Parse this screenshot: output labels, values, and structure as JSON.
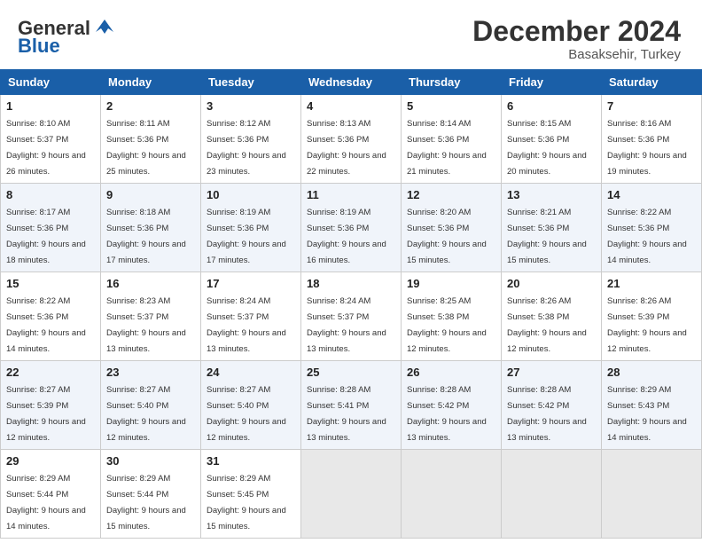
{
  "header": {
    "logo_general": "General",
    "logo_blue": "Blue",
    "month_title": "December 2024",
    "location": "Basaksehir, Turkey"
  },
  "calendar": {
    "days_of_week": [
      "Sunday",
      "Monday",
      "Tuesday",
      "Wednesday",
      "Thursday",
      "Friday",
      "Saturday"
    ],
    "weeks": [
      [
        {
          "day": "1",
          "sunrise": "8:10 AM",
          "sunset": "5:37 PM",
          "daylight": "9 hours and 26 minutes."
        },
        {
          "day": "2",
          "sunrise": "8:11 AM",
          "sunset": "5:36 PM",
          "daylight": "9 hours and 25 minutes."
        },
        {
          "day": "3",
          "sunrise": "8:12 AM",
          "sunset": "5:36 PM",
          "daylight": "9 hours and 23 minutes."
        },
        {
          "day": "4",
          "sunrise": "8:13 AM",
          "sunset": "5:36 PM",
          "daylight": "9 hours and 22 minutes."
        },
        {
          "day": "5",
          "sunrise": "8:14 AM",
          "sunset": "5:36 PM",
          "daylight": "9 hours and 21 minutes."
        },
        {
          "day": "6",
          "sunrise": "8:15 AM",
          "sunset": "5:36 PM",
          "daylight": "9 hours and 20 minutes."
        },
        {
          "day": "7",
          "sunrise": "8:16 AM",
          "sunset": "5:36 PM",
          "daylight": "9 hours and 19 minutes."
        }
      ],
      [
        {
          "day": "8",
          "sunrise": "8:17 AM",
          "sunset": "5:36 PM",
          "daylight": "9 hours and 18 minutes."
        },
        {
          "day": "9",
          "sunrise": "8:18 AM",
          "sunset": "5:36 PM",
          "daylight": "9 hours and 17 minutes."
        },
        {
          "day": "10",
          "sunrise": "8:19 AM",
          "sunset": "5:36 PM",
          "daylight": "9 hours and 17 minutes."
        },
        {
          "day": "11",
          "sunrise": "8:19 AM",
          "sunset": "5:36 PM",
          "daylight": "9 hours and 16 minutes."
        },
        {
          "day": "12",
          "sunrise": "8:20 AM",
          "sunset": "5:36 PM",
          "daylight": "9 hours and 15 minutes."
        },
        {
          "day": "13",
          "sunrise": "8:21 AM",
          "sunset": "5:36 PM",
          "daylight": "9 hours and 15 minutes."
        },
        {
          "day": "14",
          "sunrise": "8:22 AM",
          "sunset": "5:36 PM",
          "daylight": "9 hours and 14 minutes."
        }
      ],
      [
        {
          "day": "15",
          "sunrise": "8:22 AM",
          "sunset": "5:36 PM",
          "daylight": "9 hours and 14 minutes."
        },
        {
          "day": "16",
          "sunrise": "8:23 AM",
          "sunset": "5:37 PM",
          "daylight": "9 hours and 13 minutes."
        },
        {
          "day": "17",
          "sunrise": "8:24 AM",
          "sunset": "5:37 PM",
          "daylight": "9 hours and 13 minutes."
        },
        {
          "day": "18",
          "sunrise": "8:24 AM",
          "sunset": "5:37 PM",
          "daylight": "9 hours and 13 minutes."
        },
        {
          "day": "19",
          "sunrise": "8:25 AM",
          "sunset": "5:38 PM",
          "daylight": "9 hours and 12 minutes."
        },
        {
          "day": "20",
          "sunrise": "8:26 AM",
          "sunset": "5:38 PM",
          "daylight": "9 hours and 12 minutes."
        },
        {
          "day": "21",
          "sunrise": "8:26 AM",
          "sunset": "5:39 PM",
          "daylight": "9 hours and 12 minutes."
        }
      ],
      [
        {
          "day": "22",
          "sunrise": "8:27 AM",
          "sunset": "5:39 PM",
          "daylight": "9 hours and 12 minutes."
        },
        {
          "day": "23",
          "sunrise": "8:27 AM",
          "sunset": "5:40 PM",
          "daylight": "9 hours and 12 minutes."
        },
        {
          "day": "24",
          "sunrise": "8:27 AM",
          "sunset": "5:40 PM",
          "daylight": "9 hours and 12 minutes."
        },
        {
          "day": "25",
          "sunrise": "8:28 AM",
          "sunset": "5:41 PM",
          "daylight": "9 hours and 13 minutes."
        },
        {
          "day": "26",
          "sunrise": "8:28 AM",
          "sunset": "5:42 PM",
          "daylight": "9 hours and 13 minutes."
        },
        {
          "day": "27",
          "sunrise": "8:28 AM",
          "sunset": "5:42 PM",
          "daylight": "9 hours and 13 minutes."
        },
        {
          "day": "28",
          "sunrise": "8:29 AM",
          "sunset": "5:43 PM",
          "daylight": "9 hours and 14 minutes."
        }
      ],
      [
        {
          "day": "29",
          "sunrise": "8:29 AM",
          "sunset": "5:44 PM",
          "daylight": "9 hours and 14 minutes."
        },
        {
          "day": "30",
          "sunrise": "8:29 AM",
          "sunset": "5:44 PM",
          "daylight": "9 hours and 15 minutes."
        },
        {
          "day": "31",
          "sunrise": "8:29 AM",
          "sunset": "5:45 PM",
          "daylight": "9 hours and 15 minutes."
        },
        null,
        null,
        null,
        null
      ]
    ]
  },
  "labels": {
    "sunrise": "Sunrise:",
    "sunset": "Sunset:",
    "daylight": "Daylight:"
  }
}
